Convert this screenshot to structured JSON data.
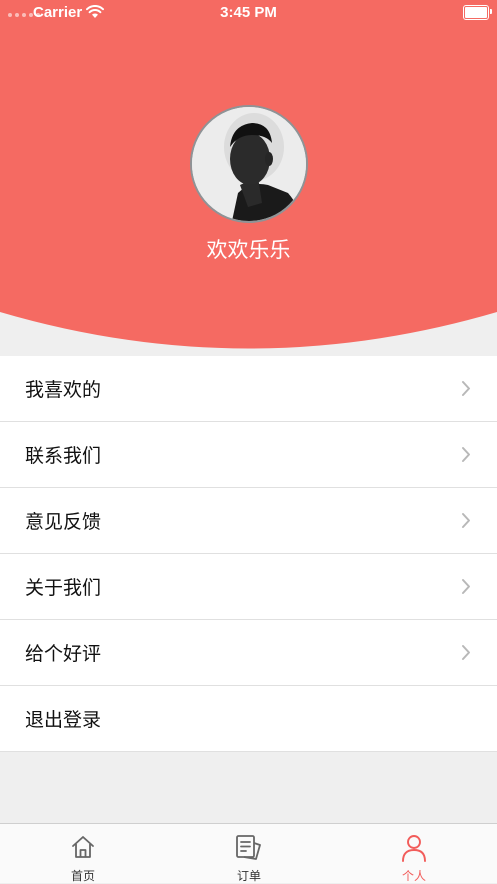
{
  "colors": {
    "header_bg": "#f56a62",
    "accent": "#f25c5a",
    "page_bg": "#efefef"
  },
  "status_bar": {
    "carrier": "Carrier",
    "time": "3:45 PM"
  },
  "profile": {
    "username": "欢欢乐乐"
  },
  "menu": {
    "items": [
      {
        "label": "我喜欢的"
      },
      {
        "label": "联系我们"
      },
      {
        "label": "意见反馈"
      },
      {
        "label": "关于我们"
      },
      {
        "label": "给个好评"
      },
      {
        "label": "退出登录"
      }
    ]
  },
  "tabbar": {
    "tabs": [
      {
        "label": "首页",
        "icon": "home-icon"
      },
      {
        "label": "订单",
        "icon": "orders-icon"
      },
      {
        "label": "个人",
        "icon": "person-icon",
        "active": true
      }
    ]
  }
}
